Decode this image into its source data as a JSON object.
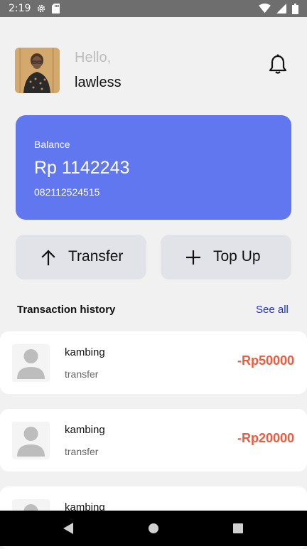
{
  "status_bar": {
    "time": "2:19",
    "icons": [
      "settings-icon",
      "sd-card-icon",
      "wifi-icon",
      "signal-icon",
      "battery-icon"
    ]
  },
  "header": {
    "greeting": "Hello,",
    "username": "lawless",
    "notification_icon": "bell-icon"
  },
  "balance": {
    "label": "Balance",
    "amount": "Rp 1142243",
    "phone": "082112524515",
    "card_color": "#6177f0"
  },
  "actions": [
    {
      "label": "Transfer",
      "icon": "arrow-up-icon"
    },
    {
      "label": "Top Up",
      "icon": "plus-icon"
    }
  ],
  "history": {
    "title": "Transaction history",
    "see_all": "See all",
    "items": [
      {
        "name": "kambing",
        "type": "transfer",
        "amount": "-Rp50000"
      },
      {
        "name": "kambing",
        "type": "transfer",
        "amount": "-Rp20000"
      },
      {
        "name": "kambing",
        "type": "",
        "amount": ""
      }
    ]
  },
  "colors": {
    "accent": "#6177f0",
    "negative_amount": "#ef5b3c",
    "link": "#1a33d6",
    "background": "#f1f1f1"
  },
  "nav_bar": {
    "buttons": [
      "back-icon",
      "home-icon",
      "recents-icon"
    ]
  }
}
